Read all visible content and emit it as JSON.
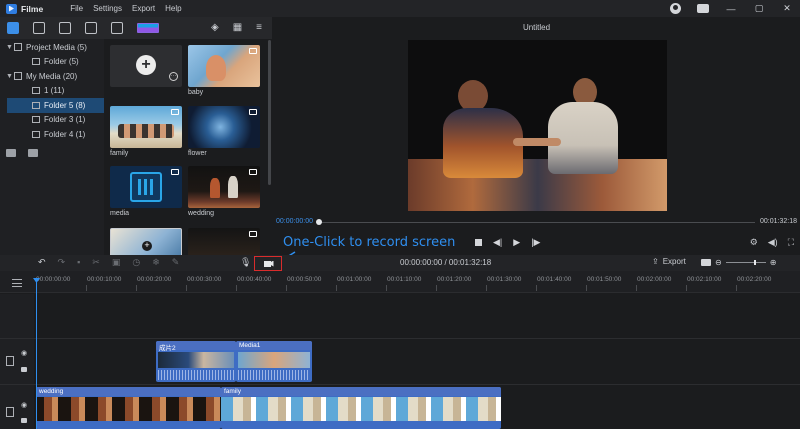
{
  "app": {
    "name": "Filme"
  },
  "menu": {
    "items": [
      "File",
      "Settings",
      "Export",
      "Help"
    ]
  },
  "window": {
    "title": "Untitled"
  },
  "media_toolbar": {
    "icons": [
      "media-icon",
      "audio-icon",
      "transition-icon",
      "text-icon",
      "filter-icon",
      "template-icon"
    ],
    "right_icons": [
      "layers-icon",
      "grid-view-icon",
      "menu-icon"
    ]
  },
  "tree": {
    "items": [
      {
        "label": "Project Media (5)",
        "level": 0,
        "expanded": true
      },
      {
        "label": "Folder (5)",
        "level": 1
      },
      {
        "label": "My Media (20)",
        "level": 0,
        "expanded": true
      },
      {
        "label": "1 (11)",
        "level": 1
      },
      {
        "label": "Folder 5 (8)",
        "level": 1,
        "selected": true
      },
      {
        "label": "Folder 3 (1)",
        "level": 1
      },
      {
        "label": "Folder 4 (1)",
        "level": 1
      }
    ]
  },
  "media": {
    "items": [
      {
        "label": "baby"
      },
      {
        "label": "family"
      },
      {
        "label": "flower"
      },
      {
        "label": "media"
      },
      {
        "label": "wedding"
      }
    ]
  },
  "preview": {
    "current_time": "00:00:00:00",
    "duration": "00:01:32:18"
  },
  "callout": {
    "text": "One-Click to record screen"
  },
  "timeline": {
    "timecode": "00:00:00:00 / 00:01:32:18",
    "export_label": "Export",
    "ruler": [
      "00:00:00:00",
      "00:00:10:00",
      "00:00:20:00",
      "00:00:30:00",
      "00:00:40:00",
      "00:00:50:00",
      "00:01:00:00",
      "00:01:10:00",
      "00:01:20:00",
      "00:01:30:00",
      "00:01:40:00",
      "00:01:50:00",
      "00:02:00:00",
      "00:02:10:00",
      "00:02:20:00"
    ],
    "clips": {
      "overlay_a": "成片2",
      "overlay_b": "Media1",
      "main_a": "wedding",
      "main_b": "family"
    }
  },
  "colors": {
    "accent": "#2f8ff0",
    "record_highlight": "#d92c2c",
    "selected_folder": "#1e4a75",
    "clip_header": "#4b6fc2"
  }
}
